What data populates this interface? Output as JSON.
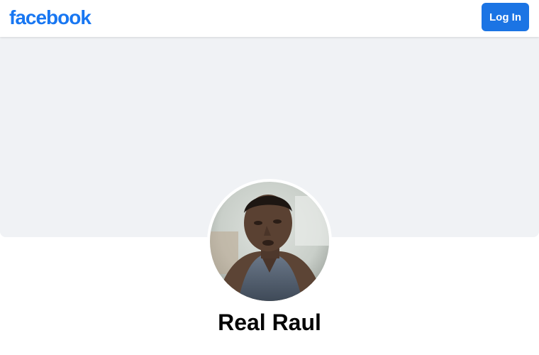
{
  "header": {
    "logo_text": "facebook",
    "login_label": "Log In"
  },
  "profile": {
    "name": "Real Raul"
  },
  "colors": {
    "brand": "#1877f2",
    "button": "#1b74e4",
    "cover": "#f0f2f5"
  }
}
